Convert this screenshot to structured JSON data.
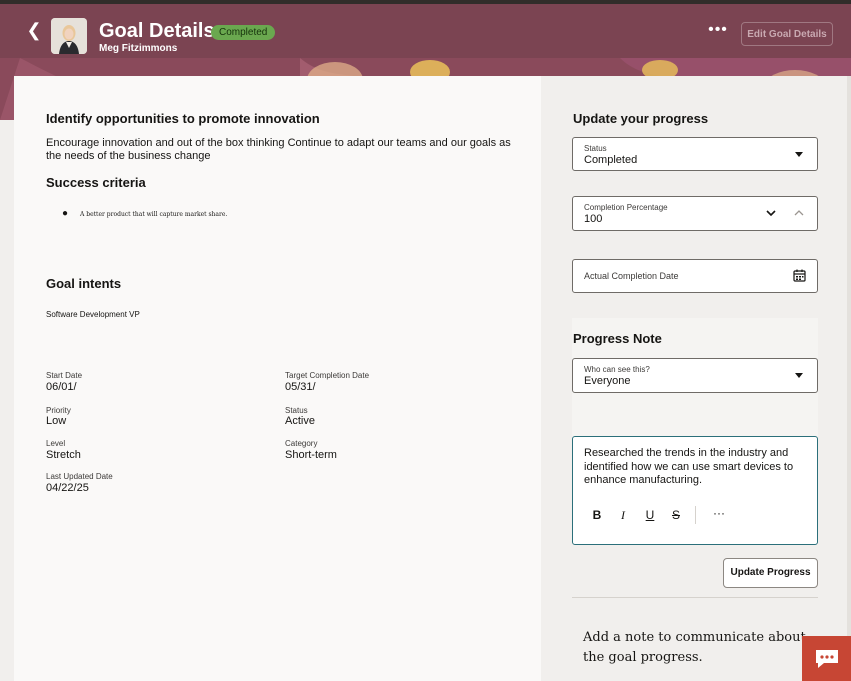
{
  "header": {
    "title": "Goal Details",
    "status_badge": "Completed",
    "subtitle": "Meg Fitzimmons",
    "more_icon": "more-horizontal-icon",
    "edit_label": "Edit Goal Details"
  },
  "colors": {
    "header_bg": "#7b4452",
    "badge_bg": "#6aa84f",
    "focus_border": "#2b6f7a",
    "chat_button": "#c74634"
  },
  "goal": {
    "name": "Identify opportunities to promote innovation",
    "description": "Encourage innovation and out of the box thinking Continue to adapt our teams and our goals as the needs of the business change",
    "success_heading": "Success criteria",
    "success_items": [
      "A better product that will capture market share."
    ],
    "intents_heading": "Goal intents",
    "intents_value": "Software Development VP"
  },
  "details": {
    "start_date_label": "Start Date",
    "start_date": "06/01/",
    "target_label": "Target Completion Date",
    "target_date": "05/31/",
    "priority_label": "Priority",
    "priority": "Low",
    "status_label": "Status",
    "status": "Active",
    "level_label": "Level",
    "level": "Stretch",
    "category_label": "Category",
    "category": "Short-term",
    "updated_label": "Last Updated Date",
    "updated_date": "04/22/25"
  },
  "progress": {
    "heading": "Update your progress",
    "status_label": "Status",
    "status_value": "Completed",
    "completion_label": "Completion Percentage",
    "completion_value": "100",
    "actual_date_label": "Actual Completion Date",
    "note_heading": "Progress Note",
    "visibility_label": "Who can see this?",
    "visibility_value": "Everyone",
    "note_text": "Researched the trends in the industry and identified how we can use smart devices to enhance manufacturing.",
    "toolbar": {
      "bold": "B",
      "italic": "I",
      "underline": "U",
      "strike": "S",
      "more": "···"
    },
    "update_button": "Update Progress",
    "empty_note": "Add a note to communicate about the goal progress."
  }
}
